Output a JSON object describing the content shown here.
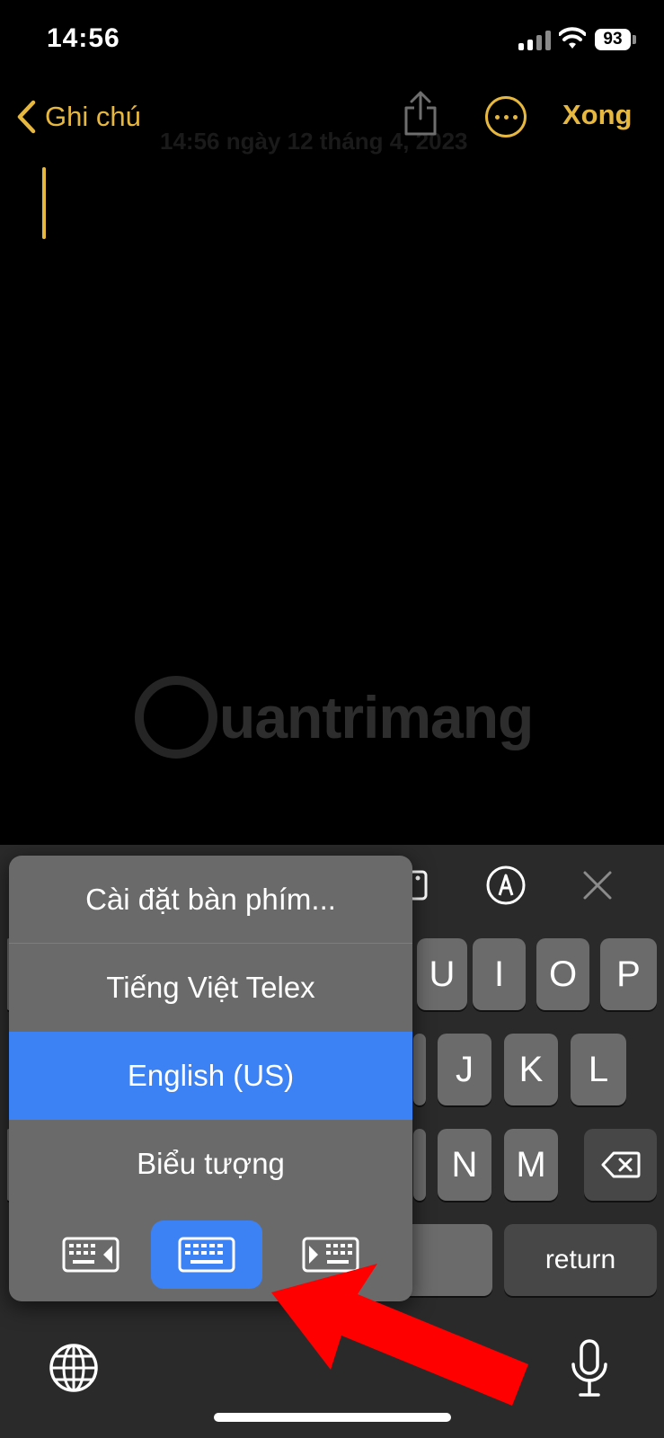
{
  "status": {
    "time": "14:56",
    "battery": "93"
  },
  "nav": {
    "back_label": "Ghi chú",
    "done_label": "Xong",
    "faint_date": "14:56 ngày 12 tháng 4, 2023"
  },
  "watermark": {
    "text": "uantrimang"
  },
  "language_menu": {
    "items": [
      {
        "label": "Cài đặt bàn phím..."
      },
      {
        "label": "Tiếng Việt Telex"
      },
      {
        "label": "English (US)"
      },
      {
        "label": "Biểu tượng"
      }
    ],
    "selected_item": "English (US)",
    "modes": [
      "keyboard-left-icon",
      "keyboard-full-icon",
      "keyboard-right-icon"
    ],
    "selected_mode": "keyboard-full-icon"
  },
  "keyboard": {
    "row1_visible": [
      "U",
      "I",
      "O",
      "P"
    ],
    "row2_visible": [
      "J",
      "K",
      "L"
    ],
    "row3_visible": [
      "N",
      "M"
    ],
    "return_label": "return"
  },
  "colors": {
    "accent": "#e7b83f",
    "selection": "#3d82f4",
    "annotation_arrow": "#ff0000"
  }
}
